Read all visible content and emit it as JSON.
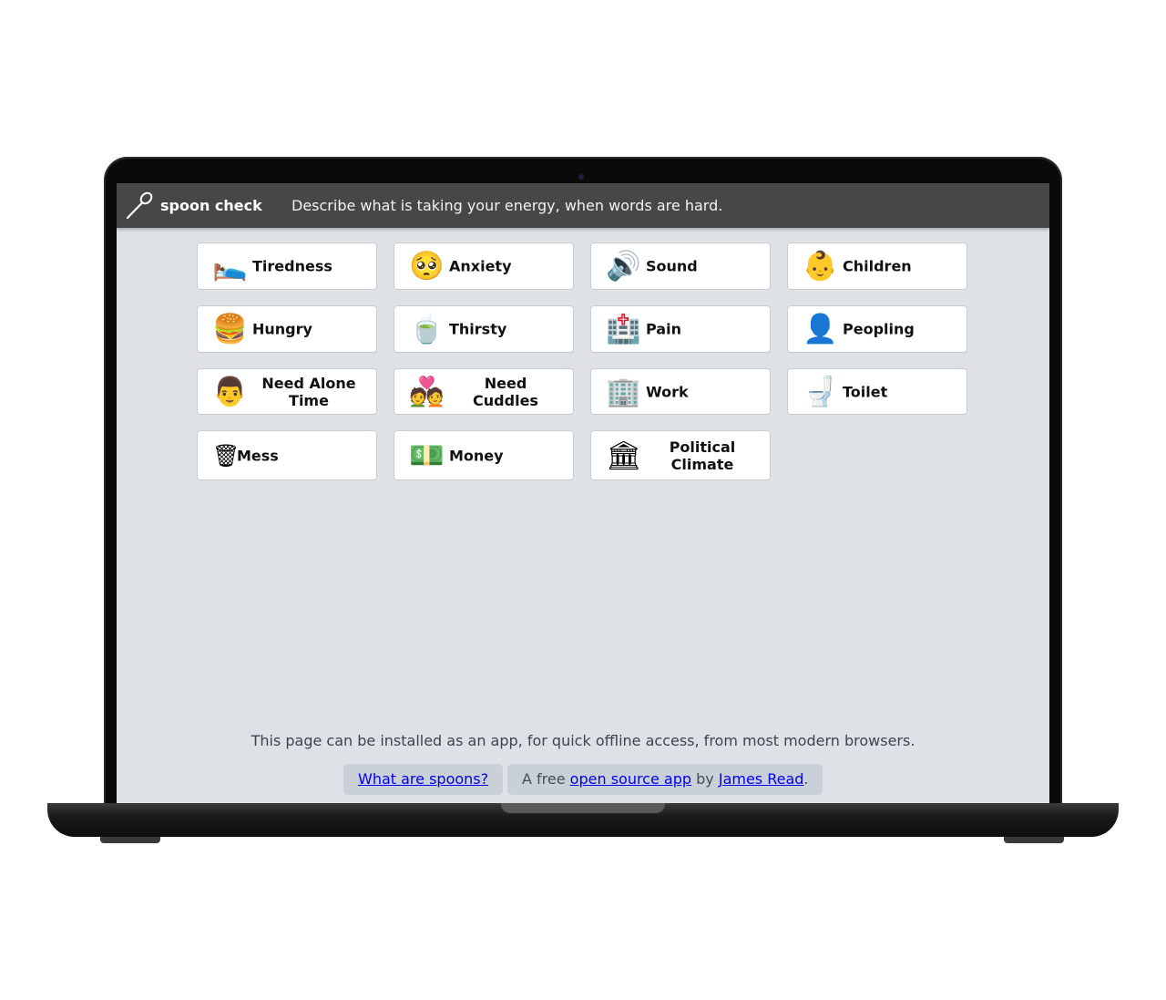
{
  "app": {
    "title": "spoon check",
    "tagline": "Describe what is taking your energy, when words are hard."
  },
  "tiles": [
    {
      "emoji": "🛌",
      "label": "Tiredness"
    },
    {
      "emoji": "🥺",
      "label": "Anxiety"
    },
    {
      "emoji": "🔊",
      "label": "Sound"
    },
    {
      "emoji": "👶",
      "label": "Children"
    },
    {
      "emoji": "🍔",
      "label": "Hungry"
    },
    {
      "emoji": "🍵",
      "label": "Thirsty"
    },
    {
      "emoji": "🏥",
      "label": "Pain"
    },
    {
      "emoji": "👤",
      "label": "Peopling"
    },
    {
      "emoji": "👨",
      "label": "Need Alone Time"
    },
    {
      "emoji": "💑",
      "label": "Need Cuddles"
    },
    {
      "emoji": "🏢",
      "label": "Work"
    },
    {
      "emoji": "🚽",
      "label": "Toilet"
    },
    {
      "emoji": "🗑",
      "label": "Mess"
    },
    {
      "emoji": "💵",
      "label": "Money"
    },
    {
      "emoji": "🏛",
      "label": "Political Climate"
    }
  ],
  "footer": {
    "install_note": "This page can be installed as an app, for quick offline access, from most modern browsers.",
    "spoons_link": "What are spoons?",
    "credit_prefix": "A free",
    "credit_link": "open source app",
    "credit_by": "by",
    "author_link": "James Read",
    "credit_suffix": "."
  },
  "icons": {
    "logo": "spoon-icon"
  },
  "colors": {
    "topbar": "#474747",
    "background": "#dee2e6",
    "tile": "#ffffff",
    "link": "#0000ee",
    "pill": "#c9d0d8"
  }
}
